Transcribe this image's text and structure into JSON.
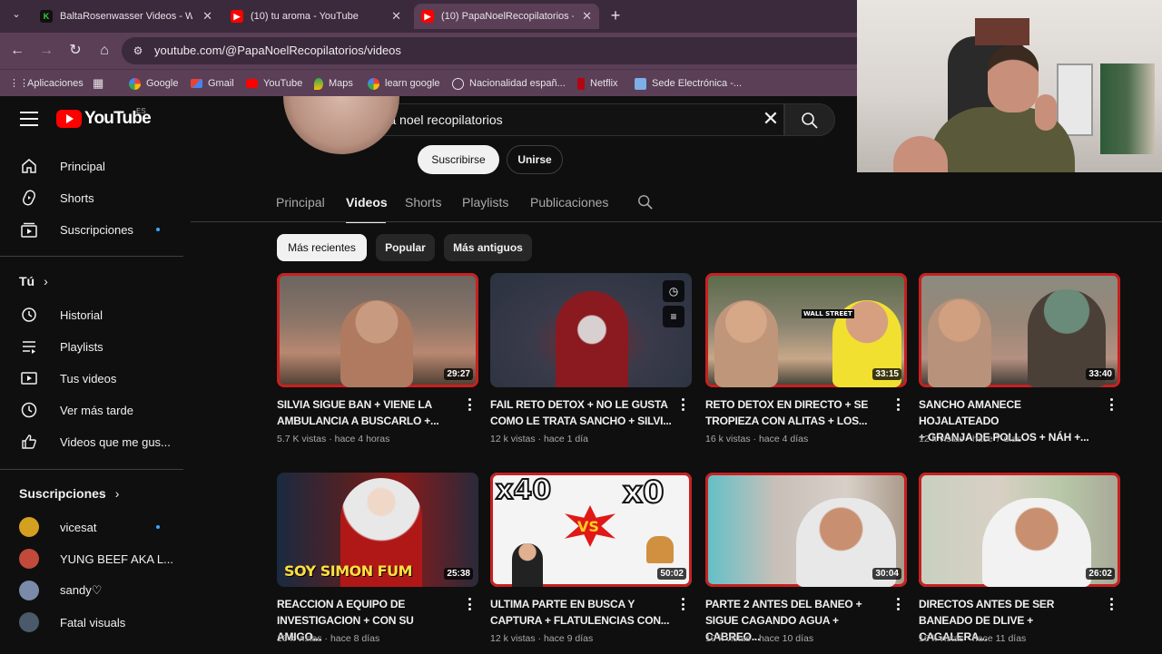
{
  "browser": {
    "tabs": [
      {
        "label": "BaltaRosenwasser Videos - Wat",
        "favicon": "k-icon",
        "active": false
      },
      {
        "label": "(10) tu aroma - YouTube",
        "favicon": "youtube-icon",
        "active": false
      },
      {
        "label": "(10) PapaNoelRecopilatorios - Y",
        "favicon": "youtube-icon",
        "active": true
      }
    ],
    "url": "youtube.com/@PapaNoelRecopilatorios/videos",
    "bookmarks": [
      {
        "label": "Aplicaciones",
        "icon": "apps-icon"
      },
      {
        "label": "Google",
        "icon": "google-icon"
      },
      {
        "label": "Gmail",
        "icon": "gmail-icon"
      },
      {
        "label": "YouTube",
        "icon": "youtube-icon"
      },
      {
        "label": "Maps",
        "icon": "maps-icon"
      },
      {
        "label": "learn google",
        "icon": "google-icon"
      },
      {
        "label": "Nacionalidad españ...",
        "icon": "globe-icon"
      },
      {
        "label": "Netflix",
        "icon": "netflix-icon"
      },
      {
        "label": "Sede Electrónica -...",
        "icon": "document-icon"
      }
    ]
  },
  "youtube": {
    "logo_word": "YouTube",
    "region": "ES",
    "search_query": "papa noel recopilatorios",
    "sidebar": {
      "main": [
        {
          "label": "Principal",
          "icon": "home-icon"
        },
        {
          "label": "Shorts",
          "icon": "shorts-icon"
        },
        {
          "label": "Suscripciones",
          "icon": "subscriptions-icon"
        }
      ],
      "you_heading": "Tú",
      "you": [
        {
          "label": "Historial",
          "icon": "history-icon"
        },
        {
          "label": "Playlists",
          "icon": "playlists-icon"
        },
        {
          "label": "Tus videos",
          "icon": "your-videos-icon"
        },
        {
          "label": "Ver más tarde",
          "icon": "watch-later-icon"
        },
        {
          "label": "Videos que me gus...",
          "icon": "like-icon"
        }
      ],
      "subs_heading": "Suscripciones",
      "subscriptions": [
        {
          "label": "vicesat",
          "color": "#d4a020"
        },
        {
          "label": "YUNG BEEF AKA L...",
          "color": "#c24a3a"
        },
        {
          "label": "sandy♡",
          "color": "#7a8aa8"
        },
        {
          "label": "Fatal visuals",
          "color": "#4a5a6a"
        }
      ]
    },
    "channel": {
      "subscribe_label": "Suscribirse",
      "join_label": "Unirse",
      "tabs": [
        "Principal",
        "Videos",
        "Shorts",
        "Playlists",
        "Publicaciones"
      ],
      "active_tab": "Videos"
    },
    "chips": [
      "Más recientes",
      "Popular",
      "Más antiguos"
    ],
    "videos": [
      {
        "title_line1": "SILVIA SIGUE BAN + VIENE LA",
        "title_line2": "AMBULANCIA A BUSCARLO +...",
        "views": "5.7 K vistas",
        "age": "hace 4 horas",
        "duration": "29:27"
      },
      {
        "title_line1": "FAIL RETO DETOX + NO LE GUSTA",
        "title_line2": "COMO LE TRATA SANCHO + SILVI...",
        "views": "12 k vistas",
        "age": "hace 1 día",
        "duration": ""
      },
      {
        "title_line1": "RETO DETOX EN DIRECTO + SE",
        "title_line2": "TROPIEZA CON ALITAS + LOS...",
        "views": "16 k vistas",
        "age": "hace 4 días",
        "duration": "33:15"
      },
      {
        "title_line1": "SANCHO AMANECE HOJALATEADO",
        "title_line2": "+ GRANJA DE POLLOS + NÁH +...",
        "views": "12 k vistas",
        "age": "hace 7 días",
        "duration": "33:40"
      },
      {
        "title_line1": "REACCION A EQUIPO DE",
        "title_line2": "INVESTIGACION + CON SU AMIGO...",
        "views": "16 k vistas",
        "age": "hace 8 días",
        "duration": "25:38"
      },
      {
        "title_line1": "ULTIMA PARTE EN BUSCA Y",
        "title_line2": "CAPTURA + FLATULENCIAS CON...",
        "views": "12 k vistas",
        "age": "hace 9 días",
        "duration": "50:02"
      },
      {
        "title_line1": "PARTE 2 ANTES DEL BANEO +",
        "title_line2": "SIGUE CAGANDO AGUA + CABREO...",
        "views": "10 k vistas",
        "age": "hace 10 días",
        "duration": "30:04"
      },
      {
        "title_line1": "DIRECTOS ANTES DE SER",
        "title_line2": "BANEADO DE DLIVE + CAGALERA...",
        "views": "16 k vistas",
        "age": "hace 11 días",
        "duration": "26:02"
      }
    ],
    "thumb_text": {
      "soy_simon": "SOY SIMON FUM",
      "x40": "x40",
      "vs": "VS",
      "x0": "x0",
      "wall_street": "WALL STREET"
    }
  },
  "colors": {
    "accent_red": "#ff0000",
    "bg": "#0f0f0f",
    "chrome_purple": "#5a3f56",
    "unread_dot": "#3ea6ff"
  }
}
